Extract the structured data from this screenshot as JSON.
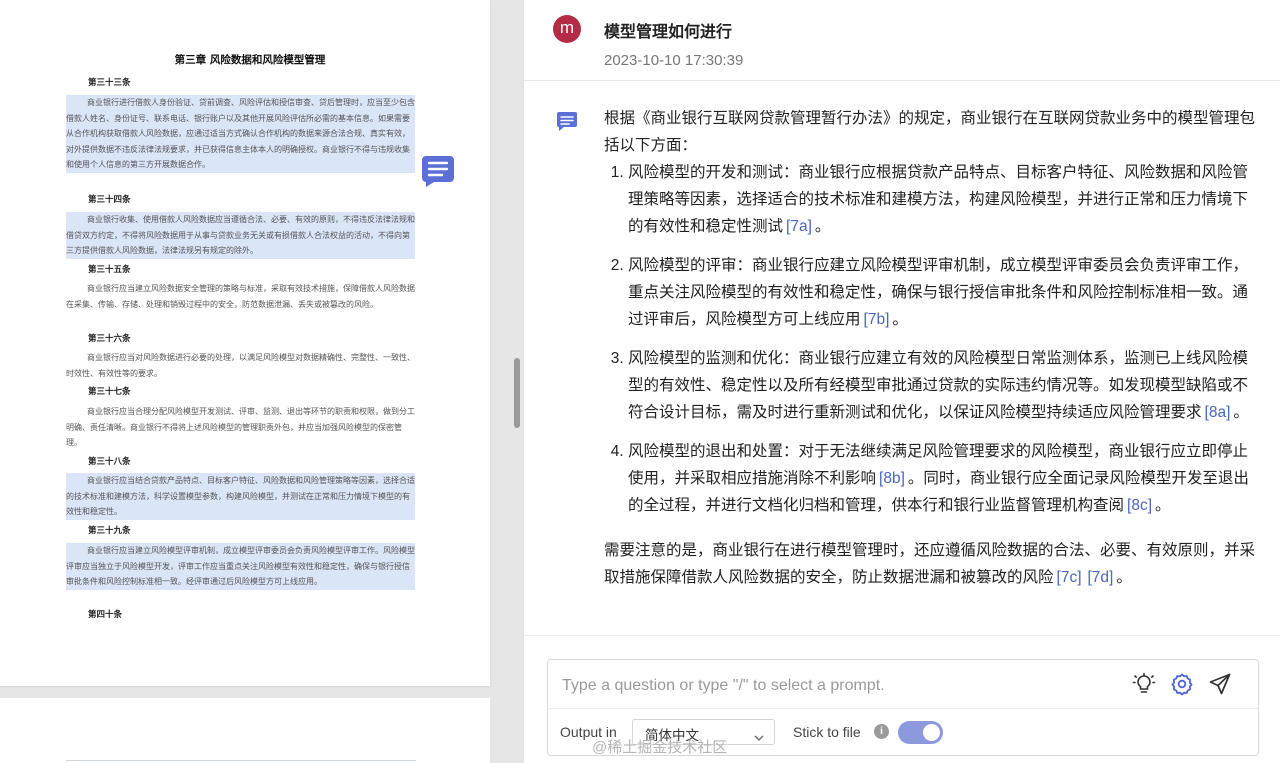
{
  "document": {
    "chapter_title": "第三章 风险数据和风险模型管理",
    "articles": [
      {
        "heading": "第三十三条",
        "text": "商业银行进行借款人身份验证、贷前调查、风险评估和授信审查、贷后管理时，应当至少包含借款人姓名、身份证号、联系电话、银行账户以及其他开展风险评估所必需的基本信息。如果需要从合作机构获取借款人风险数据，应通过适当方式确认合作机构的数据来源合法合规、真实有效，对外提供数据不违反法律法规要求，并已获得信息主体本人的明确授权。商业银行不得与违规收集和使用个人信息的第三方开展数据合作。"
      },
      {
        "heading": "第三十四条",
        "text": "商业银行收集、使用借款人风险数据应当遵循合法、必要、有效的原则，不得违反法律法规和借贷双方约定，不得将风险数据用于从事与贷款业务无关或有损借款人合法权益的活动，不得向第三方提供借款人风险数据，法律法规另有规定的除外。"
      },
      {
        "heading": "第三十五条",
        "text": "商业银行应当建立风险数据安全管理的策略与标准，采取有效技术措施，保障借款人风险数据在采集、传输、存储、处理和销毁过程中的安全，防范数据泄漏、丢失或被篡改的风险。"
      },
      {
        "heading": "第三十六条",
        "text": "商业银行应当对风险数据进行必要的处理，以满足风险模型对数据精确性、完整性、一致性、时效性、有效性等的要求。"
      },
      {
        "heading": "第三十七条",
        "text": "商业银行应当合理分配风险模型开发测试、评审、监测、退出等环节的职责和权限，做到分工明确、责任清晰。商业银行不得将上述风险模型的管理职责外包，并应当加强风险模型的保密管理。"
      },
      {
        "heading": "第三十八条",
        "text": "商业银行应当结合贷款产品特点、目标客户特征、风险数据和风险管理策略等因素，选择合适的技术标准和建模方法，科学设置模型参数，构建风险模型，并测试在正常和压力情境下模型的有效性和稳定性。"
      },
      {
        "heading": "第三十九条",
        "text": "商业银行应当建立风险模型评审机制，成立模型评审委员会负责风险模型评审工作。风险模型评审应当独立于风险模型开发，评审工作应当重点关注风险模型有效性和稳定性，确保与银行授信审批条件和风险控制标准相一致。经评审通过后风险模型方可上线应用。"
      },
      {
        "heading": "第四十条",
        "text": ""
      }
    ]
  },
  "chat": {
    "avatar_letter": "m",
    "question": "模型管理如何进行",
    "timestamp": "2023-10-10 17:30:39",
    "answer": {
      "intro": "根据《商业银行互联网贷款管理暂行办法》的规定，商业银行在互联网贷款业务中的模型管理包括以下方面：",
      "items": [
        {
          "text": "风险模型的开发和测试：商业银行应根据贷款产品特点、目标客户特征、风险数据和风险管理策略等因素，选择适合的技术标准和建模方法，构建风险模型，并进行正常和压力情境下的有效性和稳定性测试",
          "cite": "[7a]"
        },
        {
          "text": "风险模型的评审：商业银行应建立风险模型评审机制，成立模型评审委员会负责评审工作，重点关注风险模型的有效性和稳定性，确保与银行授信审批条件和风险控制标准相一致。通过评审后，风险模型方可上线应用",
          "cite": "[7b]"
        },
        {
          "text": "风险模型的监测和优化：商业银行应建立有效的风险模型日常监测体系，监测已上线风险模型的有效性、稳定性以及所有经模型审批通过贷款的实际违约情况等。如发现模型缺陷或不符合设计目标，需及时进行重新测试和优化，以保证风险模型持续适应风险管理要求",
          "cite": "[8a]"
        },
        {
          "text_a": "风险模型的退出和处置：对于无法继续满足风险管理要求的风险模型，商业银行应立即停止使用，并采取相应措施消除不利影响",
          "cite_a": "[8b]",
          "text_b": "。同时，商业银行应全面记录风险模型开发至退出的全过程，并进行文档化归档和管理，供本行和银行业监督管理机构查阅",
          "cite_b": "[8c]"
        }
      ],
      "note": "需要注意的是，商业银行在进行模型管理时，还应遵循风险数据的合法、必要、有效原则，并采取措施保障借款人风险数据的安全，防止数据泄漏和被篡改的风险",
      "note_cite_1": "[7c]",
      "note_cite_2": "[7d]",
      "period": "。"
    }
  },
  "input": {
    "placeholder": "Type a question or type \"/\" to select a prompt.",
    "output_label": "Output in",
    "language": "简体中文",
    "stick_label": "Stick to file",
    "info_glyph": "i",
    "stick_enabled": true
  },
  "watermark": "@稀土掘金技术社区",
  "colors": {
    "avatar": "#b32b45",
    "citation": "#4a66c0",
    "toggle_on": "#8c99dc",
    "highlight": "#dbe5f8",
    "accent_icon": "#5b6fd6"
  },
  "icons": [
    "chat-bubble-icon",
    "bulb-icon",
    "gear-icon",
    "send-icon",
    "chevron-down-icon",
    "info-icon"
  ]
}
